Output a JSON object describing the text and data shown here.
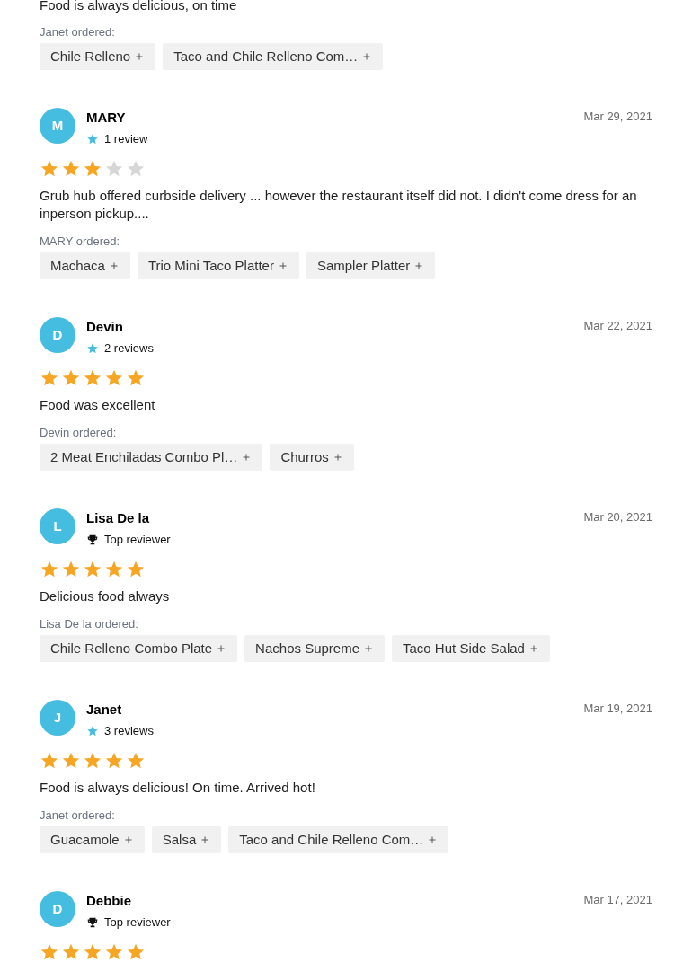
{
  "partial_review": {
    "text": "Food is always delicious, on time",
    "ordered_label": "Janet ordered:",
    "items": [
      "Chile Relleno",
      "Taco and Chile Relleno Com…"
    ]
  },
  "reviews": [
    {
      "initial": "M",
      "name": "MARY",
      "badge": {
        "kind": "count",
        "label": "1 review"
      },
      "date": "Mar 29, 2021",
      "stars": 3,
      "text": "Grub hub offered curbside delivery ... however the restaurant itself did not. I didn't come dress for an inperson pickup....",
      "ordered_label": "MARY ordered:",
      "items": [
        "Machaca",
        "Trio Mini Taco Platter",
        "Sampler Platter"
      ]
    },
    {
      "initial": "D",
      "name": "Devin",
      "badge": {
        "kind": "count",
        "label": "2 reviews"
      },
      "date": "Mar 22, 2021",
      "stars": 5,
      "text": "Food was excellent",
      "ordered_label": "Devin ordered:",
      "items": [
        "2 Meat Enchiladas Combo Pl…",
        "Churros"
      ]
    },
    {
      "initial": "L",
      "name": "Lisa De la",
      "badge": {
        "kind": "top",
        "label": "Top reviewer"
      },
      "date": "Mar 20, 2021",
      "stars": 5,
      "text": "Delicious food always",
      "ordered_label": "Lisa De la ordered:",
      "items": [
        "Chile Relleno Combo Plate",
        "Nachos Supreme",
        "Taco Hut Side Salad"
      ]
    },
    {
      "initial": "J",
      "name": "Janet",
      "badge": {
        "kind": "count",
        "label": "3 reviews"
      },
      "date": "Mar 19, 2021",
      "stars": 5,
      "text": "Food is always delicious! On time. Arrived hot!",
      "ordered_label": "Janet ordered:",
      "items": [
        "Guacamole",
        "Salsa",
        "Taco and Chile Relleno Com…"
      ]
    },
    {
      "initial": "D",
      "name": "Debbie",
      "badge": {
        "kind": "top",
        "label": "Top reviewer"
      },
      "date": "Mar 17, 2021",
      "stars": 5
    }
  ]
}
